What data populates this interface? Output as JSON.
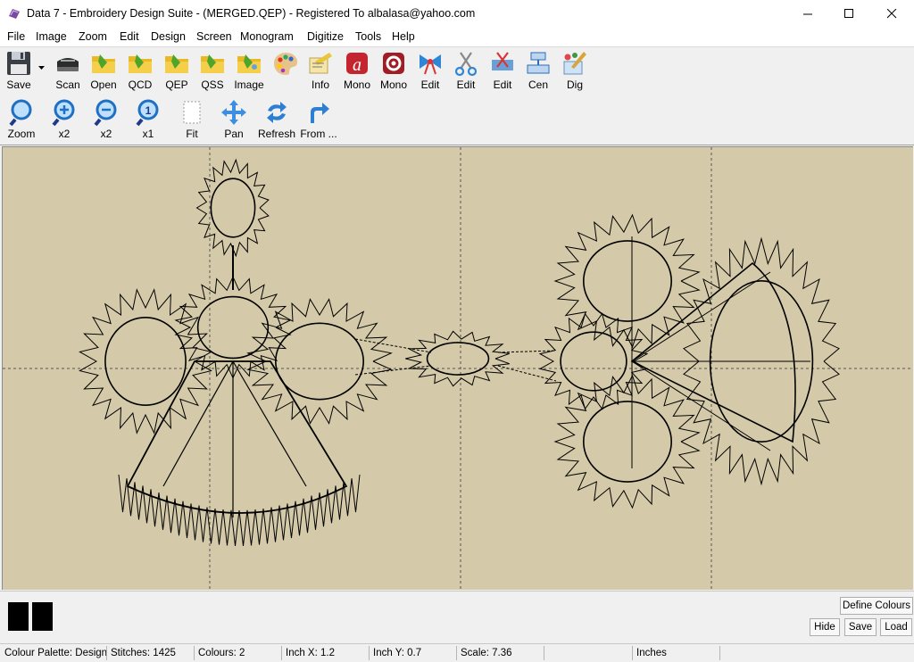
{
  "window": {
    "title": "Data 7 - Embroidery Design Suite - (MERGED.QEP) - Registered To albalasa@yahoo.com"
  },
  "menu": [
    "File",
    "Image",
    "Zoom",
    "Edit",
    "Design",
    "Screen",
    "Monogram",
    "Digitize",
    "Tools",
    "Help"
  ],
  "toolbar1": [
    {
      "label": "Save",
      "icon": "floppy-disk-icon"
    },
    {
      "label": "Scan",
      "icon": "scanner-icon"
    },
    {
      "label": "Open",
      "icon": "folder-icon"
    },
    {
      "label": "QCD",
      "icon": "folder-icon"
    },
    {
      "label": "QEP",
      "icon": "folder-icon"
    },
    {
      "label": "QSS",
      "icon": "folder-icon"
    },
    {
      "label": "Image",
      "icon": "folder-image-icon"
    },
    {
      "label": "",
      "icon": "palette-icon"
    },
    {
      "label": "Info",
      "icon": "info-note-icon"
    },
    {
      "label": "Mono",
      "icon": "monogram-a-icon"
    },
    {
      "label": "Mono",
      "icon": "monogram-gear-icon"
    },
    {
      "label": "Edit",
      "icon": "bow-edit-icon"
    },
    {
      "label": "Edit",
      "icon": "scissors-icon"
    },
    {
      "label": "Edit",
      "icon": "cut-edit-icon"
    },
    {
      "label": "Cen",
      "icon": "center-icon"
    },
    {
      "label": "Dig",
      "icon": "digitize-icon"
    }
  ],
  "toolbar2": [
    {
      "label": "Zoom",
      "icon": "magnifier-icon"
    },
    {
      "label": "x2",
      "icon": "zoom-in-icon"
    },
    {
      "label": "x2",
      "icon": "zoom-out-icon"
    },
    {
      "label": "x1",
      "icon": "zoom-one-icon"
    },
    {
      "label": "Fit",
      "icon": "fit-page-icon"
    },
    {
      "label": "Pan",
      "icon": "pan-arrows-icon"
    },
    {
      "label": "Refresh",
      "icon": "refresh-icon"
    },
    {
      "label": "From ...",
      "icon": "redo-arrow-icon"
    }
  ],
  "palette": {
    "swatches": [
      "#000000",
      "#000000"
    ],
    "define_colours": "Define Colours",
    "hide": "Hide",
    "save": "Save",
    "load": "Load"
  },
  "colors": {
    "canvas": "#d4c9a8",
    "stitch": "#000000",
    "grid": "#555555"
  },
  "status": {
    "palette": "Colour Palette: Design",
    "stitches": "Stitches: 1425",
    "colours": "Colours: 2",
    "inch_x": "Inch X: 1.2",
    "inch_y": "Inch Y: 0.7",
    "scale": "Scale: 7.36",
    "blank": "",
    "units": "Inches"
  }
}
